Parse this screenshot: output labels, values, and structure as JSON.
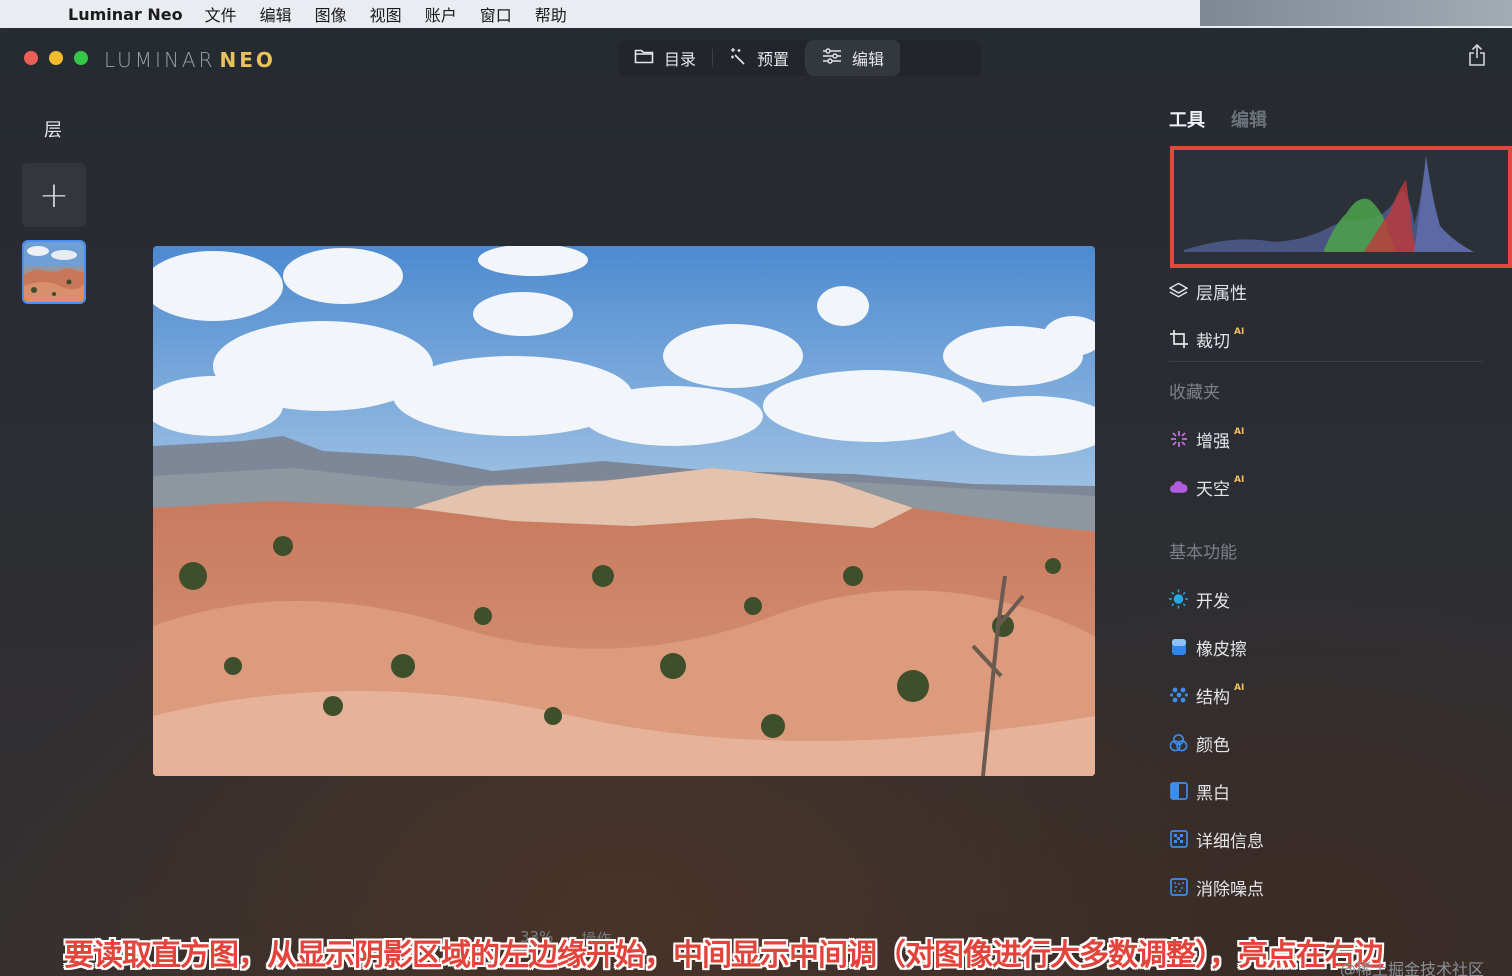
{
  "menubar": {
    "app_name": "Luminar Neo",
    "items": [
      "文件",
      "编辑",
      "图像",
      "视图",
      "账户",
      "窗口",
      "帮助"
    ]
  },
  "app": {
    "logo_left": "LUMINAR",
    "logo_right": "NEO"
  },
  "topnav": {
    "tabs": [
      {
        "label": "目录",
        "icon": "folder-icon"
      },
      {
        "label": "预置",
        "icon": "magic-wand-icon"
      },
      {
        "label": "编辑",
        "icon": "sliders-icon",
        "active": true
      }
    ]
  },
  "layers": {
    "title": "层",
    "add_label": "+"
  },
  "right_panel": {
    "tabs": [
      "工具",
      "编辑"
    ],
    "histogram_highlight_color": "#e2483e",
    "tools_top": [
      {
        "label": "层属性",
        "icon": "layers-icon",
        "ai": ""
      },
      {
        "label": "裁切",
        "icon": "crop-icon",
        "ai": "AI"
      }
    ],
    "favorites_label": "收藏夹",
    "favorites": [
      {
        "label": "增强",
        "icon": "enhance-sparkle-icon",
        "ai": "AI"
      },
      {
        "label": "天空",
        "icon": "cloud-icon",
        "ai": "AI"
      }
    ],
    "basics_label": "基本功能",
    "basics": [
      {
        "label": "开发",
        "icon": "sun-icon",
        "ai": ""
      },
      {
        "label": "橡皮擦",
        "icon": "eraser-icon",
        "ai": ""
      },
      {
        "label": "结构",
        "icon": "structure-dots-icon",
        "ai": "AI"
      },
      {
        "label": "颜色",
        "icon": "color-circles-icon",
        "ai": ""
      },
      {
        "label": "黑白",
        "icon": "black-white-icon",
        "ai": ""
      },
      {
        "label": "详细信息",
        "icon": "details-grid-icon",
        "ai": ""
      },
      {
        "label": "消除噪点",
        "icon": "denoise-icon",
        "ai": ""
      }
    ]
  },
  "bottom": {
    "zoom": "33%",
    "actions": "操作"
  },
  "caption": "要读取直方图，从显示阴影区域的左边缘开始，中间显示中间调（对图像进行大多数调整），亮点在右边",
  "watermark": "@稀土掘金技术社区"
}
